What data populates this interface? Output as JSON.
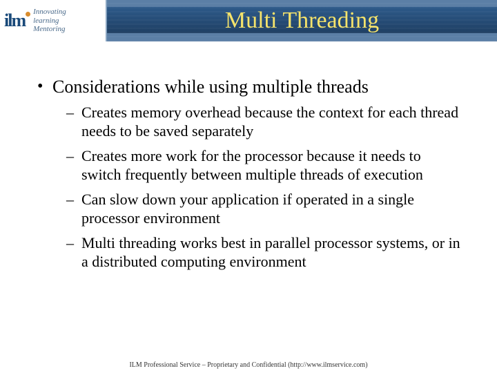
{
  "logo": {
    "mark": "ilm",
    "line1": "Innovating",
    "line2": "learning",
    "line3": "Mentoring"
  },
  "title": "Multi Threading",
  "bullets": {
    "main": "Considerations while using multiple threads",
    "subs": [
      "Creates memory overhead because the context for each thread needs to be saved separately",
      "Creates more work for the processor because it needs to switch frequently between multiple threads of execution",
      "Can slow down your application if operated in a single processor environment",
      "Multi threading works best in parallel processor systems, or in a distributed computing environment"
    ]
  },
  "footer": "ILM Professional Service – Proprietary and Confidential (http://www.ilmservice.com)"
}
